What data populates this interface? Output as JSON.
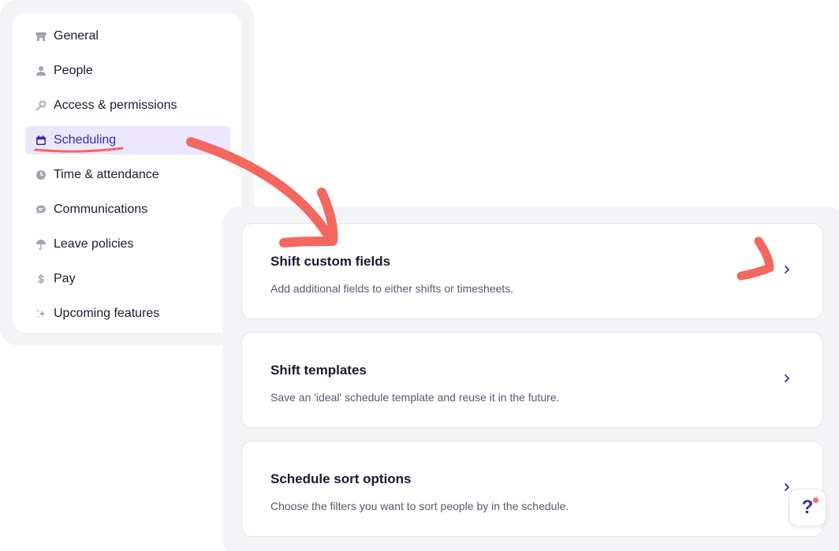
{
  "sidebar": {
    "items": [
      {
        "label": "General",
        "icon": "store-icon"
      },
      {
        "label": "People",
        "icon": "person-icon"
      },
      {
        "label": "Access & permissions",
        "icon": "key-icon"
      },
      {
        "label": "Scheduling",
        "icon": "calendar-icon",
        "active": true
      },
      {
        "label": "Time & attendance",
        "icon": "clock-icon"
      },
      {
        "label": "Communications",
        "icon": "chat-icon"
      },
      {
        "label": "Leave policies",
        "icon": "umbrella-icon"
      },
      {
        "label": "Pay",
        "icon": "dollar-icon"
      },
      {
        "label": "Upcoming features",
        "icon": "sparkle-icon"
      }
    ]
  },
  "main": {
    "cards": [
      {
        "title": "Shift custom fields",
        "description": "Add additional fields to either shifts or timesheets."
      },
      {
        "title": "Shift templates",
        "description": "Save an 'ideal' schedule template and reuse it in the future."
      },
      {
        "title": "Schedule sort options",
        "description": "Choose the filters you want to sort people by in the schedule."
      }
    ]
  },
  "help": {
    "label": "?"
  },
  "colors": {
    "accent": "#3b2aa8",
    "active_bg": "#ece7fd",
    "annotation": "#f4675f",
    "icon_gray": "#a3a3b2"
  }
}
